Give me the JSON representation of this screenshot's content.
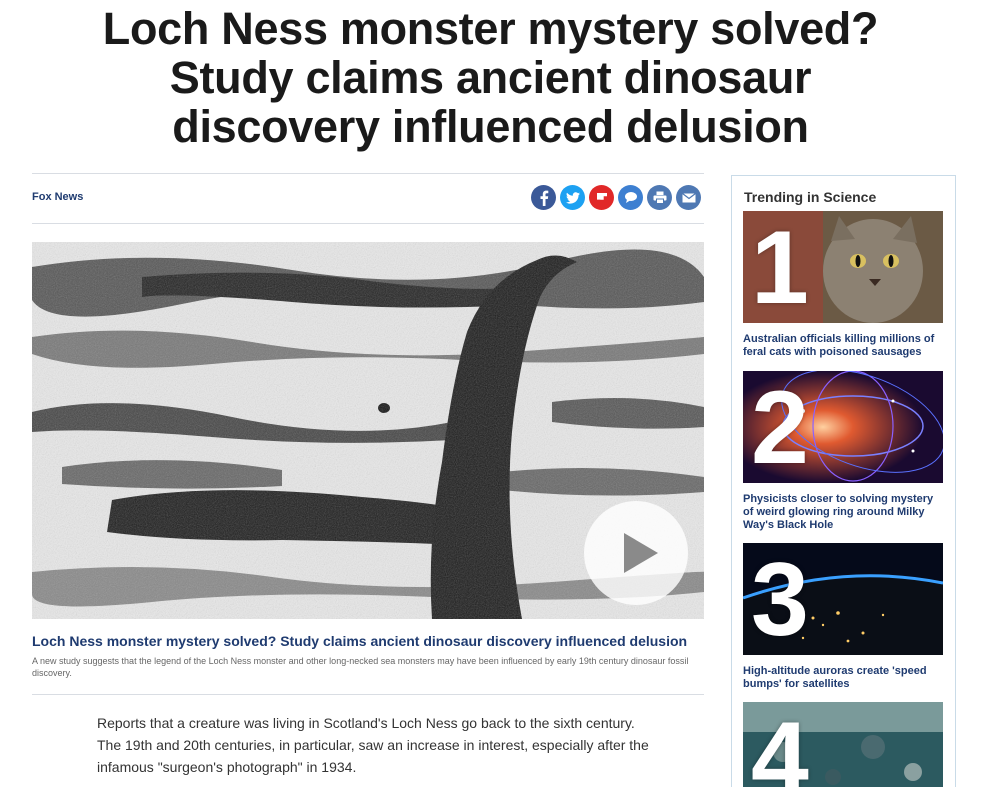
{
  "headline": {
    "line1": "Loch Ness monster mystery solved?",
    "line2": "Study claims ancient dinosaur",
    "line3": "discovery influenced delusion"
  },
  "byline": "Fox News",
  "share": {
    "icons": [
      "facebook-icon",
      "twitter-icon",
      "flipboard-icon",
      "comment-icon",
      "print-icon",
      "email-icon"
    ],
    "colors": {
      "facebook": "#3b5998",
      "twitter": "#1da1f2",
      "flipboard": "#e12828",
      "comment": "#3d7fd1",
      "print": "#4e78b3",
      "email": "#4e78b3"
    }
  },
  "video": {
    "caption_title": "Loch Ness monster mystery solved? Study claims ancient dinosaur discovery influenced delusion",
    "caption_text": "A new study suggests that the legend of the Loch Ness monster and other long-necked sea monsters may have been influenced by early 19th century dinosaur fossil discovery."
  },
  "article": {
    "paragraph1": "Reports that a creature was living in Scotland's Loch Ness go back to the sixth century. The 19th and 20th centuries, in particular, saw an increase in interest, especially after the infamous \"surgeon's photograph\" in 1934."
  },
  "sidebar": {
    "title": "Trending in Science",
    "items": [
      {
        "number": "1",
        "title": "Australian officials killing millions of feral cats with poisoned sausages"
      },
      {
        "number": "2",
        "title": "Physicists closer to solving mystery of weird glowing ring around Milky Way's Black Hole"
      },
      {
        "number": "3",
        "title": "High-altitude auroras create 'speed bumps' for satellites"
      },
      {
        "number": "4",
        "title": ""
      }
    ]
  },
  "accent_color": "#1f3b70"
}
